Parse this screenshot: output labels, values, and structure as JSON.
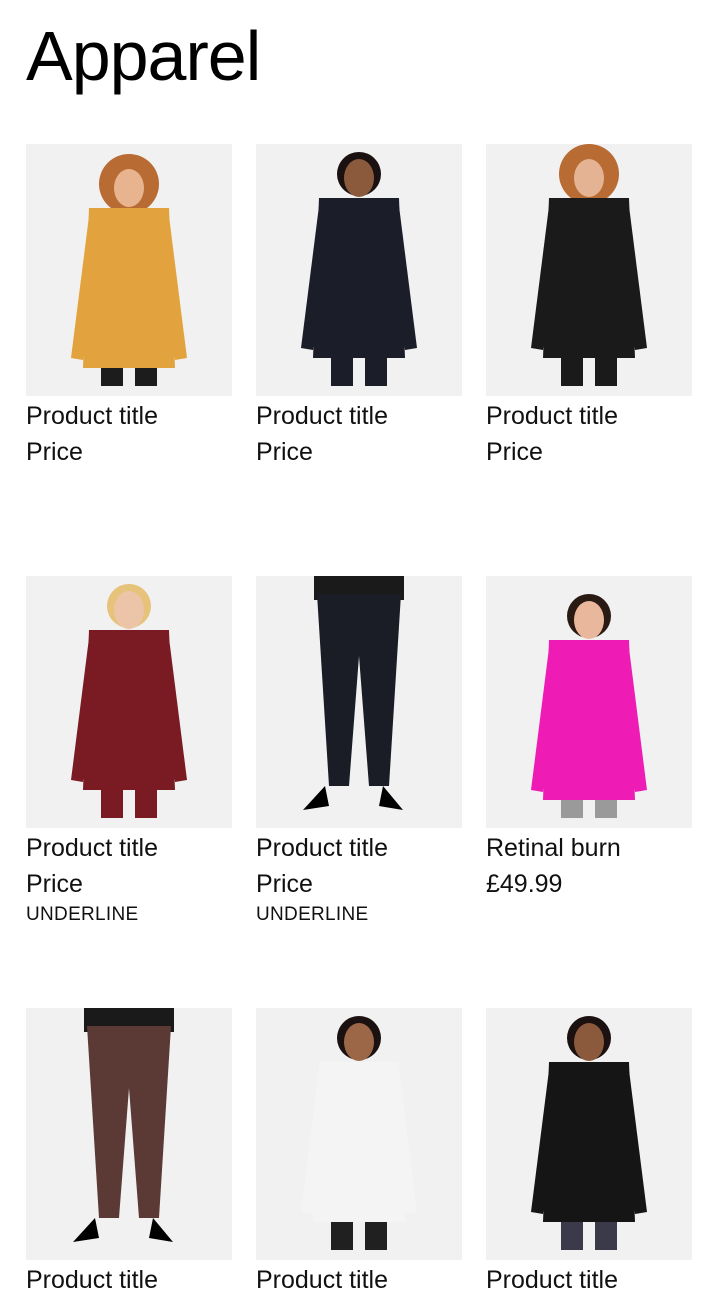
{
  "header": {
    "title": "Apparel"
  },
  "products": [
    {
      "title": "Product title",
      "price": "Price",
      "underline": "",
      "image": "woman-mustard-top-image",
      "colors": {
        "garment": "#e2a33e",
        "bottom": "#1c1c1c",
        "skin": "#e7b48f",
        "hair": "#b86b32"
      }
    },
    {
      "title": "Product title",
      "price": "Price",
      "underline": "",
      "image": "woman-black-suit-image",
      "colors": {
        "garment": "#1b1e29",
        "bottom": "#1b1e29",
        "skin": "#8b5a3c",
        "hair": "#1a1110"
      }
    },
    {
      "title": "Product title",
      "price": "Price",
      "underline": "",
      "image": "woman-star-jumpsuit-image",
      "colors": {
        "garment": "#1a1a1a",
        "bottom": "#1a1a1a",
        "skin": "#e4b394",
        "hair": "#b86b32"
      }
    },
    {
      "title": "Product title",
      "price": "Price",
      "underline": "UNDERLINE",
      "image": "woman-burgundy-dress-image",
      "colors": {
        "garment": "#7a1b24",
        "bottom": "#7a1b24",
        "skin": "#ecc4a8",
        "hair": "#e6c27a"
      }
    },
    {
      "title": "Product title",
      "price": "Price",
      "underline": "UNDERLINE",
      "image": "studded-black-jeans-image",
      "colors": {
        "garment": "#1a1c26",
        "bottom": "#1a1c26",
        "skin": "#7a4b35",
        "hair": "#1a1a1a"
      }
    },
    {
      "title": "Retinal burn",
      "price": "£49.99",
      "underline": "",
      "image": "woman-pink-jumper-image",
      "colors": {
        "garment": "#ee1cb4",
        "bottom": "#9a9a9a",
        "skin": "#e9b79c",
        "hair": "#2a1a14"
      }
    },
    {
      "title": "Product title",
      "price": "",
      "underline": "",
      "image": "metallic-jeans-image",
      "colors": {
        "garment": "#5b3a36",
        "bottom": "#5b3a36",
        "skin": "#6a3f2a",
        "hair": "#1a1a1a"
      }
    },
    {
      "title": "Product title",
      "price": "",
      "underline": "",
      "image": "woman-white-puffer-image",
      "colors": {
        "garment": "#f4f4f4",
        "bottom": "#202020",
        "skin": "#9c6747",
        "hair": "#1a1110"
      }
    },
    {
      "title": "Product title",
      "price": "",
      "underline": "",
      "image": "woman-fringe-leather-jacket-image",
      "colors": {
        "garment": "#151515",
        "bottom": "#3a3a4a",
        "skin": "#8b5a3c",
        "hair": "#1a1110"
      }
    }
  ]
}
